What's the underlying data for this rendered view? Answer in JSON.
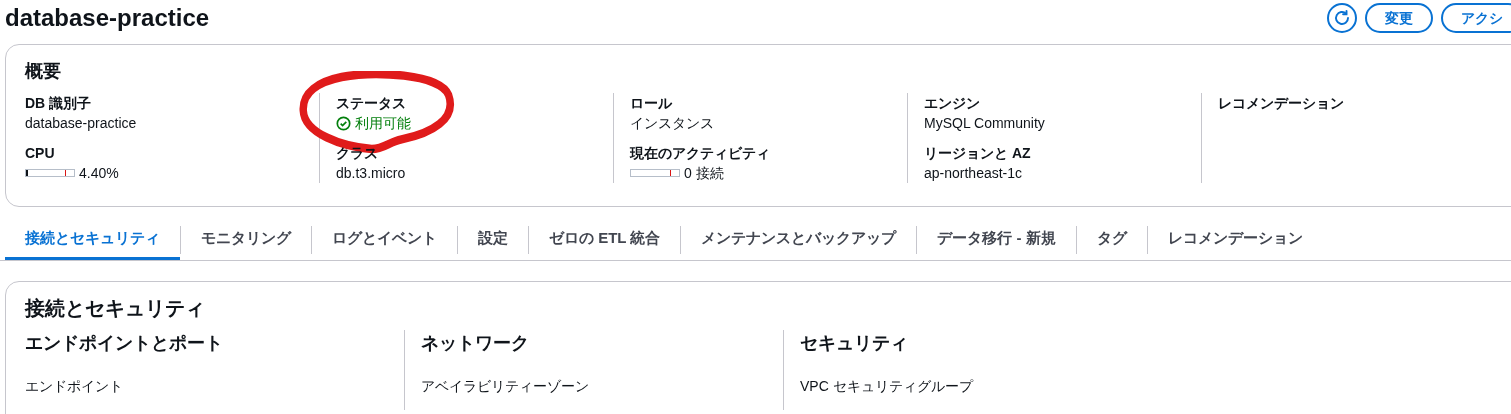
{
  "page_title": "database-practice",
  "header_buttons": [
    {
      "kind": "icon"
    },
    {
      "kind": "text",
      "label": "変更"
    },
    {
      "kind": "text",
      "label": "アクシ"
    }
  ],
  "summary": {
    "title": "概要",
    "columns": [
      {
        "fields": [
          {
            "label": "DB 識別子",
            "value": "database-practice",
            "kind": "text"
          },
          {
            "label": "CPU",
            "value": "4.40%",
            "kind": "meter",
            "level": 0.044
          }
        ]
      },
      {
        "fields": [
          {
            "label": "ステータス",
            "value": "利用可能",
            "kind": "status",
            "annotated": true
          },
          {
            "label": "クラス",
            "value": "db.t3.micro",
            "kind": "text"
          }
        ]
      },
      {
        "fields": [
          {
            "label": "ロール",
            "value": "インスタンス",
            "kind": "text"
          },
          {
            "label": "現在のアクティビティ",
            "value": "0 接続",
            "kind": "meter",
            "level": 0
          }
        ]
      },
      {
        "fields": [
          {
            "label": "エンジン",
            "value": "MySQL Community",
            "kind": "text"
          },
          {
            "label": "リージョンと AZ",
            "value": "ap-northeast-1c",
            "kind": "text"
          }
        ]
      },
      {
        "fields": [
          {
            "label": "レコメンデーション",
            "kind": "heading"
          }
        ]
      }
    ]
  },
  "tabs": [
    {
      "label": "接続とセキュリティ",
      "selected": true
    },
    {
      "label": "モニタリング",
      "selected": false
    },
    {
      "label": "ログとイベント",
      "selected": false
    },
    {
      "label": "設定",
      "selected": false
    },
    {
      "label": "ゼロの ETL 統合",
      "selected": false
    },
    {
      "label": "メンテナンスとバックアップ",
      "selected": false
    },
    {
      "label": "データ移行 - 新規",
      "selected": false
    },
    {
      "label": "タグ",
      "selected": false
    },
    {
      "label": "レコメンデーション",
      "selected": false
    }
  ],
  "section": {
    "title": "接続とセキュリティ",
    "columns": [
      {
        "heading": "エンドポイントとポート",
        "first_label": "エンドポイント"
      },
      {
        "heading": "ネットワーク",
        "first_label": "アベイラビリティーゾーン"
      },
      {
        "heading": "セキュリティ",
        "first_label": "VPC セキュリティグループ"
      }
    ]
  }
}
